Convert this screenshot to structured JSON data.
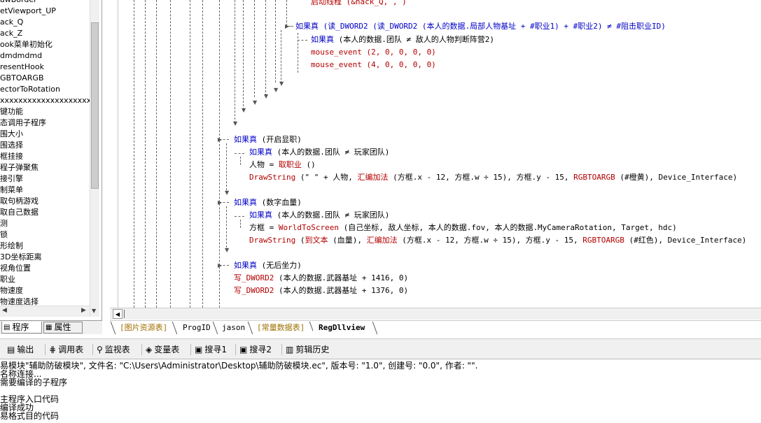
{
  "tree_items": [
    "awBorder",
    "etViewport_UP",
    "ack_Q",
    "ack_Z",
    "ook菜单初始化",
    "dmdmdmd",
    "resentHook",
    "GBTOARGB",
    "ectorToRotation",
    "xxxxxxxxxxxxxxxxxxxx",
    "键功能",
    "态调用子程序",
    "围大小",
    "围选择",
    "框挂接",
    "程子弹聚焦",
    "接引擎",
    "制菜单",
    "取句柄游戏",
    "取自己数据",
    "测",
    "锁",
    "形绘制",
    "3D坐标距离",
    "视角位置",
    "职业",
    "物速度",
    "物速度选择"
  ],
  "left_tabs": {
    "program": "程序",
    "properties": "属性"
  },
  "code_lines": {
    "l0": "启动线程 (&hack_Q, , )",
    "l1_kw": "如果真",
    "l1": " (读_DWORD2 (读_DWORD2 (本人的数据.局部人物基址 + #职业1) + #职业2) ≠ #阻击职业ID)",
    "l2_kw": "如果真",
    "l2": " (本人的数据.团队 ≠ 敌人的人物判断阵营2)",
    "l3": "mouse_event (2, 0, 0, 0, 0)",
    "l4": "mouse_event (4, 0, 0, 0, 0)",
    "l5_kw": "如果真",
    "l5": " (开启显职)",
    "l6_kw": "如果真",
    "l6": " (本人的数据.团队 ≠ 玩家团队)",
    "l7": "人物 = ",
    "l7b": "取职业",
    "l7c": " ()",
    "l8a": "DrawString",
    "l8b": " (\"    \" + 人物, ",
    "l8c": "汇编加法",
    "l8d": " (方框.x - 12, 方框.w ÷ 15), 方框.y - 15, ",
    "l8e": "RGBTOARGB",
    "l8f": " (#橙黄), Device_Interface)",
    "l9_kw": "如果真",
    "l9": " (数字血量)",
    "l10_kw": "如果真",
    "l10": " (本人的数据.团队 ≠ 玩家团队)",
    "l11": "方框 = ",
    "l11b": "WorldToScreen",
    "l11c": " (自己坐标, 敌人坐标, 本人的数据.fov, 本人的数据.MyCameraRotation, Target, hdc)",
    "l12a": "DrawString",
    "l12b": " (",
    "l12c": "到文本",
    "l12d": " (血量), ",
    "l12e": "汇编加法",
    "l12f": " (方框.x - 12, 方框.w ÷ 15), 方框.y - 15, ",
    "l12g": "RGBTOARGB",
    "l12h": " (#红色), Device_Interface)",
    "l13_kw": "如果真",
    "l13": " (无后坐力)",
    "l14a": "写_DWORD2",
    "l14b": " (本人的数据.武器基址 + 1416, 0)",
    "l15a": "写_DWORD2",
    "l15b": " (本人的数据.武器基址 + 1376, 0)"
  },
  "editor_tabs": [
    "[图片资源表]",
    "ProgID",
    "jason",
    "[常量数据表]",
    "RegDllview"
  ],
  "toolbar": {
    "output": "输出",
    "call_table": "调用表",
    "watch_table": "监视表",
    "var_table": "变量表",
    "search1": "搜寻1",
    "search2": "搜寻2",
    "clip_history": "剪辑历史"
  },
  "output_lines": [
    "易模块\"辅助防破模块\", 文件名: \"C:\\Users\\Administrator\\Desktop\\辅助防破模块.ec\", 版本号: \"1.0\", 创建号: \"0.0\", 作者: \"\".",
    "名称连接...",
    "需要编译的子程序",
    "",
    "主程序入口代码",
    "编译成功",
    "易格式目的代码"
  ],
  "colors": {
    "keyword": "#0000c8",
    "function": "#b40000",
    "constant_tab": "#a07000"
  }
}
